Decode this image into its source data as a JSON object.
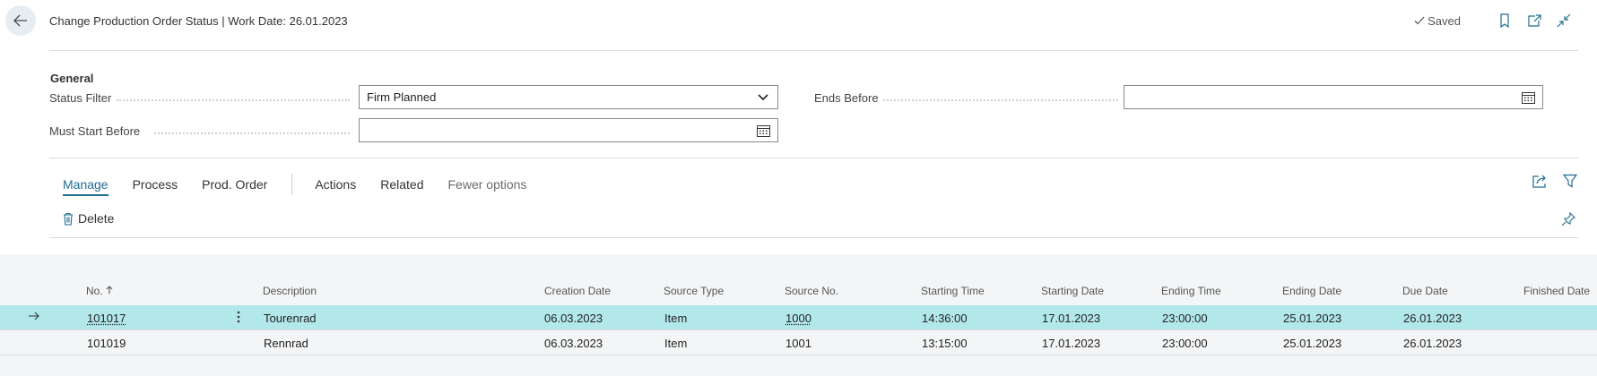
{
  "header": {
    "title": "Change Production Order Status | Work Date: 26.01.2023",
    "saved_label": "Saved"
  },
  "general": {
    "section_title": "General",
    "status_filter_label": "Status Filter",
    "status_filter_value": "Firm Planned",
    "must_start_before_label": "Must Start Before",
    "must_start_before_value": "",
    "ends_before_label": "Ends Before",
    "ends_before_value": ""
  },
  "actionbar": {
    "manage": "Manage",
    "process": "Process",
    "prod_order": "Prod. Order",
    "actions": "Actions",
    "related": "Related",
    "fewer_options": "Fewer options"
  },
  "manage_actions": {
    "delete": "Delete"
  },
  "table": {
    "columns": {
      "no": "No.",
      "description": "Description",
      "creation_date": "Creation Date",
      "source_type": "Source Type",
      "source_no": "Source No.",
      "starting_time": "Starting Time",
      "starting_date": "Starting Date",
      "ending_time": "Ending Time",
      "ending_date": "Ending Date",
      "due_date": "Due Date",
      "finished_date": "Finished Date"
    },
    "rows": [
      {
        "no": "101017",
        "description": "Tourenrad",
        "creation_date": "06.03.2023",
        "source_type": "Item",
        "source_no": "1000",
        "starting_time": "14:36:00",
        "starting_date": "17.01.2023",
        "ending_time": "23:00:00",
        "ending_date": "25.01.2023",
        "due_date": "26.01.2023",
        "finished_date": ""
      },
      {
        "no": "101019",
        "description": "Rennrad",
        "creation_date": "06.03.2023",
        "source_type": "Item",
        "source_no": "1001",
        "starting_time": "13:15:00",
        "starting_date": "17.01.2023",
        "ending_time": "23:00:00",
        "ending_date": "25.01.2023",
        "due_date": "26.01.2023",
        "finished_date": ""
      }
    ]
  },
  "icons": {
    "back": "arrow-left-icon",
    "saved": "checkmark-icon",
    "bookmark": "bookmark-icon",
    "open_new_window": "open-in-new-window-icon",
    "collapse": "collapse-icon",
    "dropdown": "chevron-down-icon",
    "calendar": "calendar-icon",
    "share": "share-icon",
    "filter": "filter-icon",
    "delete": "trash-icon",
    "pin": "pin-icon",
    "sort": "sort-ascending-icon",
    "row_selected": "arrow-right-icon",
    "row_menu": "more-vertical-icon"
  },
  "colors": {
    "accent": "#1f6d8c",
    "selected_row": "#b3e8eb",
    "grid_background": "#f4f5f6"
  }
}
